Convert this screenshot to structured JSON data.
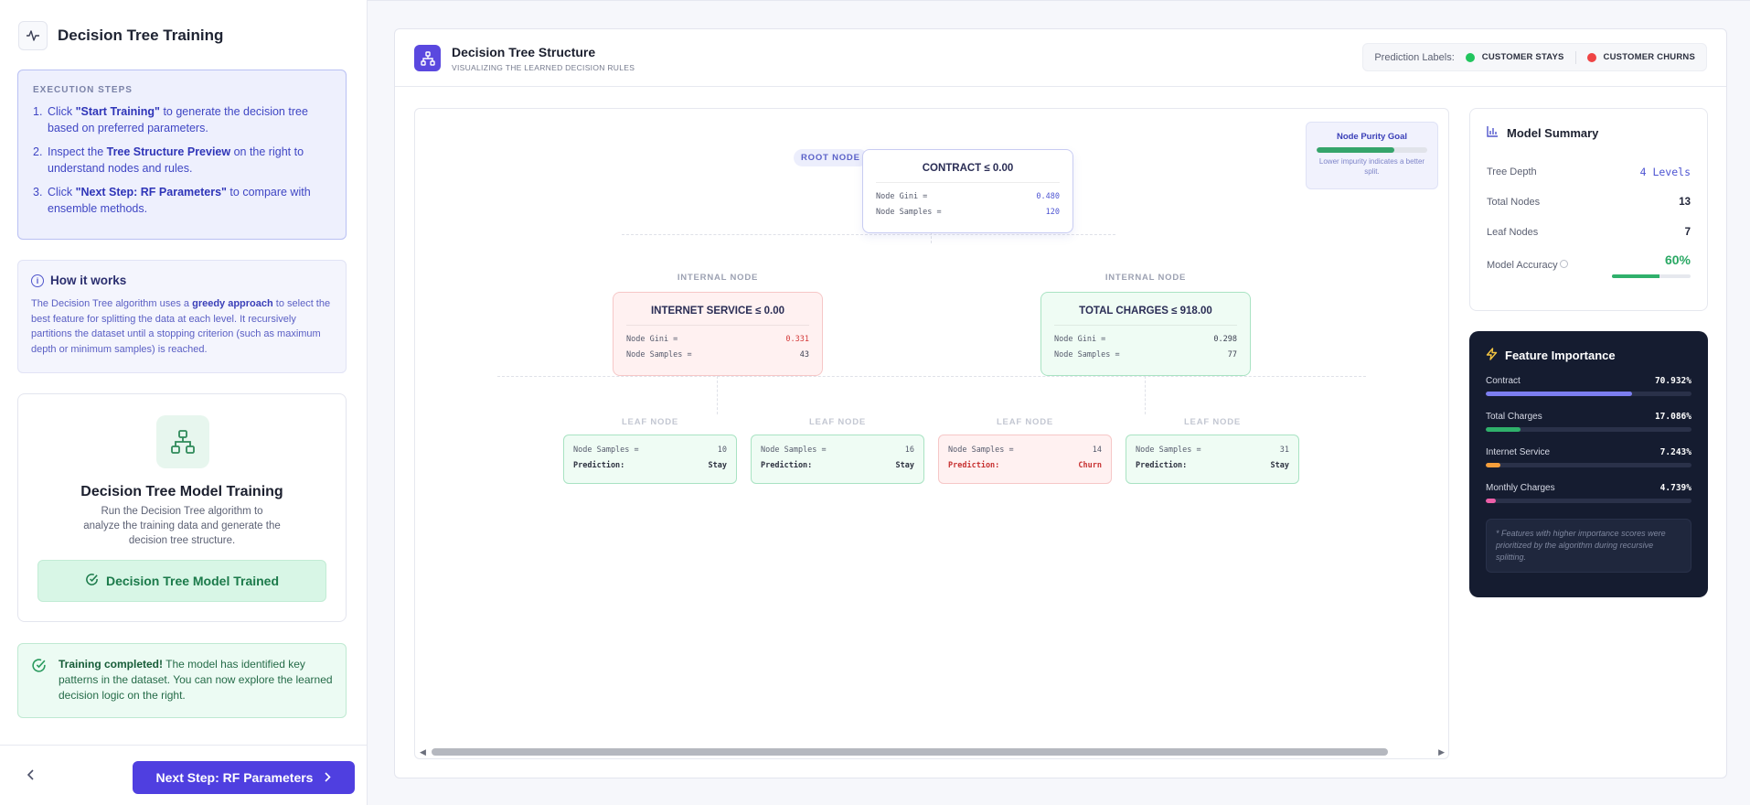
{
  "sidebar": {
    "title": "Decision Tree Training",
    "steps_caption": "EXECUTION STEPS",
    "steps": [
      {
        "n": "1.",
        "pre": "Click ",
        "bold": "\"Start Training\"",
        "post": " to generate the decision tree based on preferred parameters."
      },
      {
        "n": "2.",
        "pre": "Inspect the ",
        "bold": "Tree Structure Preview",
        "post": " on the right to understand nodes and rules."
      },
      {
        "n": "3.",
        "pre": "Click ",
        "bold": "\"Next Step: RF Parameters\"",
        "post": " to compare with ensemble methods."
      }
    ],
    "how": {
      "title": "How it works",
      "pre": "The Decision Tree algorithm uses a ",
      "bold": "greedy approach",
      "post": " to select the best feature for splitting the data at each level. It recursively partitions the dataset until a stopping criterion (such as maximum depth or minimum samples) is reached."
    },
    "training": {
      "title": "Decision Tree Model Training",
      "desc": "Run the Decision Tree algorithm to analyze the training data and generate the decision tree structure.",
      "status": "Decision Tree Model Trained"
    },
    "complete": {
      "bold": "Training completed!",
      "text": " The model has identified key patterns in the dataset. You can now explore the learned decision logic on the right."
    },
    "footer": {
      "back_icon": "chevron-left-icon",
      "next_label": "Next Step: RF Parameters"
    }
  },
  "header": {
    "title": "Decision Tree Structure",
    "subtitle": "VISUALIZING THE LEARNED DECISION RULES",
    "legend_label": "Prediction Labels:",
    "legend": [
      {
        "label": "CUSTOMER STAYS",
        "color": "#22c55e"
      },
      {
        "label": "CUSTOMER CHURNS",
        "color": "#ef4444"
      }
    ]
  },
  "tree": {
    "purity": {
      "title": "Node Purity Goal",
      "desc": "Lower impurity indicates a better split.",
      "level": 0.7
    },
    "tags": {
      "root": "ROOT NODE",
      "internal": "INTERNAL NODE",
      "leaf": "LEAF NODE"
    },
    "root": {
      "title": "CONTRACT ≤ 0.00",
      "gini_label": "Node Gini =",
      "gini": "0.480",
      "samples_label": "Node Samples =",
      "samples": "120"
    },
    "left": {
      "title": "INTERNET SERVICE ≤ 0.00",
      "gini_label": "Node Gini =",
      "gini": "0.331",
      "samples_label": "Node Samples =",
      "samples": "43"
    },
    "right": {
      "title": "TOTAL CHARGES ≤ 918.00",
      "gini_label": "Node Gini =",
      "gini": "0.298",
      "samples_label": "Node Samples =",
      "samples": "77"
    },
    "leaves": [
      {
        "samples_label": "Node Samples =",
        "samples": "10",
        "pred_label": "Prediction:",
        "pred": "Stay"
      },
      {
        "samples_label": "Node Samples =",
        "samples": "16",
        "pred_label": "Prediction:",
        "pred": "Stay"
      },
      {
        "samples_label": "Node Samples =",
        "samples": "14",
        "pred_label": "Prediction:",
        "pred": "Churn"
      },
      {
        "samples_label": "Node Samples =",
        "samples": "31",
        "pred_label": "Prediction:",
        "pred": "Stay"
      }
    ]
  },
  "summary": {
    "title": "Model Summary",
    "rows": [
      {
        "label": "Tree Depth",
        "value": "4 Levels"
      },
      {
        "label": "Total Nodes",
        "value": "13"
      },
      {
        "label": "Leaf Nodes",
        "value": "7"
      }
    ],
    "accuracy_label": "Model Accuracy",
    "accuracy": "60%",
    "accuracy_level": 0.6
  },
  "features": {
    "title": "Feature Importance",
    "items": [
      {
        "name": "Contract",
        "value": "70.932%",
        "level": 0.70932,
        "color": "#7c7ef0"
      },
      {
        "name": "Total Charges",
        "value": "17.086%",
        "level": 0.17086,
        "color": "#2fb06b"
      },
      {
        "name": "Internet Service",
        "value": "7.243%",
        "level": 0.07243,
        "color": "#f59e3b"
      },
      {
        "name": "Monthly Charges",
        "value": "4.739%",
        "level": 0.04739,
        "color": "#ec5fa8"
      }
    ],
    "note": "* Features with higher importance scores were prioritized by the algorithm during recursive splitting."
  }
}
